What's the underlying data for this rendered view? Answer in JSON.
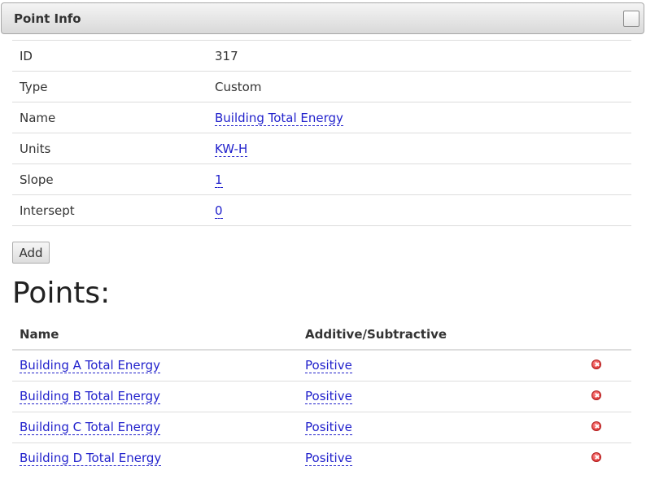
{
  "panel": {
    "title": "Point Info"
  },
  "info": {
    "rows": [
      {
        "label": "ID",
        "value": "317",
        "editable": false
      },
      {
        "label": "Type",
        "value": "Custom",
        "editable": false
      },
      {
        "label": "Name",
        "value": "Building Total Energy",
        "editable": true
      },
      {
        "label": "Units",
        "value": "KW-H",
        "editable": true
      },
      {
        "label": "Slope",
        "value": "1",
        "editable": true
      },
      {
        "label": "Intersept",
        "value": "0",
        "editable": true
      }
    ]
  },
  "add_button": {
    "label": "Add"
  },
  "points": {
    "title": "Points:",
    "headers": {
      "name": "Name",
      "sign": "Additive/Subtractive"
    },
    "rows": [
      {
        "name": "Building A Total Energy",
        "sign": "Positive",
        "action_icon": "delete-icon"
      },
      {
        "name": "Building B Total Energy",
        "sign": "Positive",
        "action_icon": "delete-icon"
      },
      {
        "name": "Building C Total Energy",
        "sign": "Positive",
        "action_icon": "delete-icon"
      },
      {
        "name": "Building D Total Energy",
        "sign": "Positive",
        "action_icon": "delete-icon"
      }
    ]
  },
  "colors": {
    "link": "#2222cc",
    "delete": "#d42020"
  }
}
